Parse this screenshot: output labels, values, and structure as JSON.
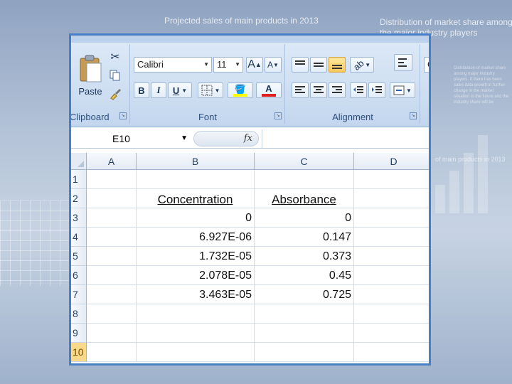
{
  "background": {
    "slide_title": "Projected sales of main products in 2013",
    "side_title": "Distribution of market share among the major industry players",
    "side_caption": "of main products in 2013",
    "paragraph": "Distribution of market share among major industry players. If there has been sales data growth in further change in the market situation in the future and the industry share will be"
  },
  "ribbon": {
    "clipboard": {
      "label": "Clipboard",
      "paste_label": "Paste",
      "paste_icon": "clipboard-paste-icon",
      "cut_icon": "scissors-icon",
      "copy_icon": "copy-icon",
      "format_painter_icon": "brush-icon"
    },
    "font": {
      "label": "Font",
      "font_name": "Calibri",
      "font_size": "11",
      "grow_label": "A",
      "shrink_label": "A",
      "bold_label": "B",
      "italic_label": "I",
      "underline_label": "U",
      "font_color_label": "A",
      "fill_color": "#ffff00",
      "font_color": "#e02020"
    },
    "alignment": {
      "label": "Alignment"
    },
    "number": {
      "partial_label": "G"
    }
  },
  "formula_bar": {
    "cell_ref": "E10",
    "fx_label": "fx",
    "value": ""
  },
  "sheet": {
    "columns": [
      "A",
      "B",
      "C",
      "D"
    ],
    "rows": [
      "1",
      "2",
      "3",
      "4",
      "5",
      "6",
      "7",
      "8",
      "9",
      "10"
    ],
    "active_row": "10",
    "headers": {
      "concentration": "Concentration",
      "absorbance": "Absorbance"
    },
    "data": [
      {
        "concentration": "0",
        "absorbance": "0"
      },
      {
        "concentration": "6.927E-06",
        "absorbance": "0.147"
      },
      {
        "concentration": "1.732E-05",
        "absorbance": "0.373"
      },
      {
        "concentration": "2.078E-05",
        "absorbance": "0.45"
      },
      {
        "concentration": "3.463E-05",
        "absorbance": "0.725"
      }
    ]
  }
}
